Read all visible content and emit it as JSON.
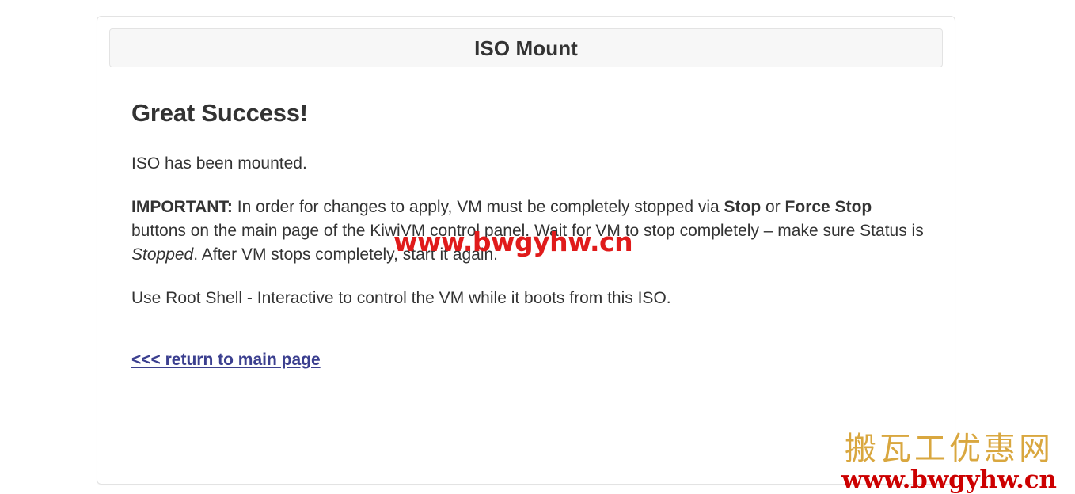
{
  "panel": {
    "heading_title": "ISO Mount"
  },
  "content": {
    "success_heading": "Great Success!",
    "mounted_text": "ISO has been mounted.",
    "important": {
      "label": "IMPORTANT:",
      "part1": " In order for changes to apply, VM must be completely stopped via ",
      "stop_bold": "Stop",
      "part2": " or ",
      "force_stop_bold": "Force Stop",
      "part3": " buttons on the main page of the KiwiVM control panel. Wait for VM to stop completely – make sure Status is ",
      "stopped_italic": "Stopped",
      "part4": ". After VM stops completely, start it again."
    },
    "root_shell_text": "Use Root Shell - Interactive to control the VM while it boots from this ISO.",
    "return_link_label": "<<< return to main page"
  },
  "watermarks": {
    "center_url": "www.bwgyhw.cn",
    "corner_chinese": "搬瓦工优惠网",
    "corner_url": "www.bwgyhw.cn"
  },
  "colors": {
    "text": "#333333",
    "link": "#3b3f8f",
    "panel_border": "#e3e3e3",
    "heading_bg": "#f7f7f7",
    "watermark_red": "#cc0000",
    "watermark_gold": "#d9a73f"
  }
}
